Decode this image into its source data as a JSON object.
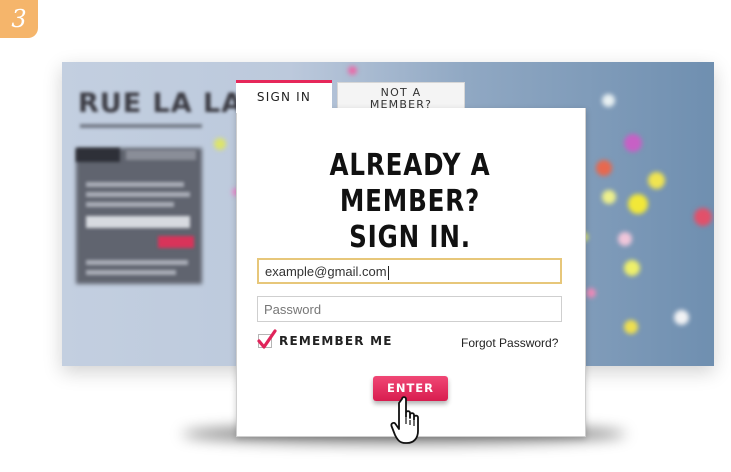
{
  "step_number": "3",
  "background_site": {
    "logo_text": "RUE LA LA"
  },
  "signin_modal": {
    "tabs": [
      {
        "label": "SIGN IN",
        "active": true
      },
      {
        "label": "NOT A MEMBER?",
        "active": false
      }
    ],
    "heading_line1": "ALREADY A MEMBER?",
    "heading_line2": "SIGN IN.",
    "email_value": "example@gmail.com",
    "password_placeholder": "Password",
    "remember_label": "REMEMBER ME",
    "remember_checked": true,
    "forgot_label": "Forgot Password?",
    "enter_label": "ENTER"
  },
  "colors": {
    "accent_pink": "#e6285a",
    "step_badge": "#f5b56b",
    "email_focus_border": "#e7c77a"
  },
  "icons": [
    "checkmark-icon",
    "hand-pointer-cursor-icon"
  ]
}
